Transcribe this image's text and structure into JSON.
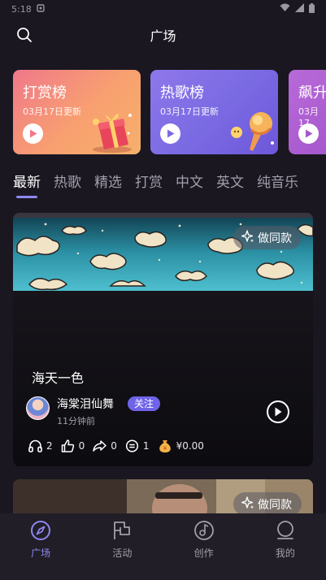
{
  "status_bar": {
    "time": "5:18"
  },
  "header": {
    "title": "广场"
  },
  "rank_cards": [
    {
      "title": "打赏榜",
      "date": "03月17日更新"
    },
    {
      "title": "热歌榜",
      "date": "03月17日更新"
    },
    {
      "title": "飙升",
      "date": "03月17"
    }
  ],
  "tabs": [
    "最新",
    "热歌",
    "精选",
    "打赏",
    "中文",
    "英文",
    "纯音乐"
  ],
  "active_tab": 0,
  "feed": [
    {
      "same_label": "做同款",
      "title": "海天一色",
      "author": "海棠泪仙舞",
      "follow_label": "关注",
      "time_ago": "11分钟前",
      "stats": {
        "listens": "2",
        "likes": "0",
        "shares": "0",
        "comments": "1",
        "reward": "¥0.00"
      }
    },
    {
      "same_label": "做同款"
    }
  ],
  "bottom_nav": [
    {
      "label": "广场",
      "icon": "compass-icon",
      "active": true
    },
    {
      "label": "活动",
      "icon": "flag-icon",
      "active": false
    },
    {
      "label": "创作",
      "icon": "disc-icon",
      "active": false
    },
    {
      "label": "我的",
      "icon": "profile-icon",
      "active": false
    }
  ],
  "colors": {
    "accent": "#8e87f0",
    "background": "#1a1721",
    "follow": "#6f64e8"
  }
}
